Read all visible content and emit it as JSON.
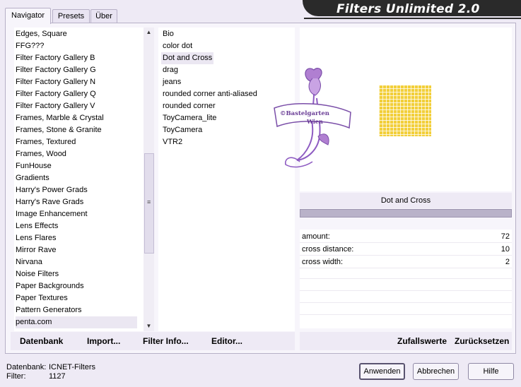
{
  "tabs": [
    "Navigator",
    "Presets",
    "Über"
  ],
  "app_title": "Filters Unlimited 2.0",
  "categories": [
    "Edges, Square",
    "FFG???",
    "Filter Factory Gallery B",
    "Filter Factory Gallery G",
    "Filter Factory Gallery N",
    "Filter Factory Gallery Q",
    "Filter Factory Gallery V",
    "Frames, Marble & Crystal",
    "Frames, Stone & Granite",
    "Frames, Textured",
    "Frames, Wood",
    "FunHouse",
    "Gradients",
    "Harry's Power Grads",
    "Harry's Rave Grads",
    "Image Enhancement",
    "Lens Effects",
    "Lens Flares",
    "Mirror Rave",
    "Nirvana",
    "Noise Filters",
    "Paper Backgrounds",
    "Paper Textures",
    "Pattern Generators",
    "penta.com"
  ],
  "selected_category": "penta.com",
  "filters": [
    "Bio",
    "color dot",
    "Dot and Cross",
    "drag",
    "jeans",
    "rounded corner anti-aliased",
    "rounded corner",
    "ToyCamera_lite",
    "ToyCamera",
    "VTR2"
  ],
  "selected_filter": "Dot and Cross",
  "left_buttons": {
    "database": "Datenbank",
    "import": "Import...",
    "filter_info": "Filter Info...",
    "editor": "Editor..."
  },
  "preview": {
    "watermark_line1": "©Bastelgarten",
    "watermark_line2": "Wien",
    "thumb_color": "#f2cf3a"
  },
  "current_filter_name": "Dot and Cross",
  "parameters": [
    {
      "name": "amount:",
      "value": "72"
    },
    {
      "name": "cross distance:",
      "value": "10"
    },
    {
      "name": "cross width:",
      "value": "2"
    }
  ],
  "right_buttons": {
    "random": "Zufallswerte",
    "reset": "Zurücksetzen"
  },
  "footer": {
    "db_label": "Datenbank:",
    "db_value": "ICNET-Filters",
    "filter_label": "Filter:",
    "filter_count": "1127"
  },
  "dialog_buttons": {
    "apply": "Anwenden",
    "cancel": "Abbrechen",
    "help": "Hilfe"
  },
  "icons": {
    "scroll_up": "▲",
    "scroll_down": "▼",
    "grip": "≡"
  }
}
